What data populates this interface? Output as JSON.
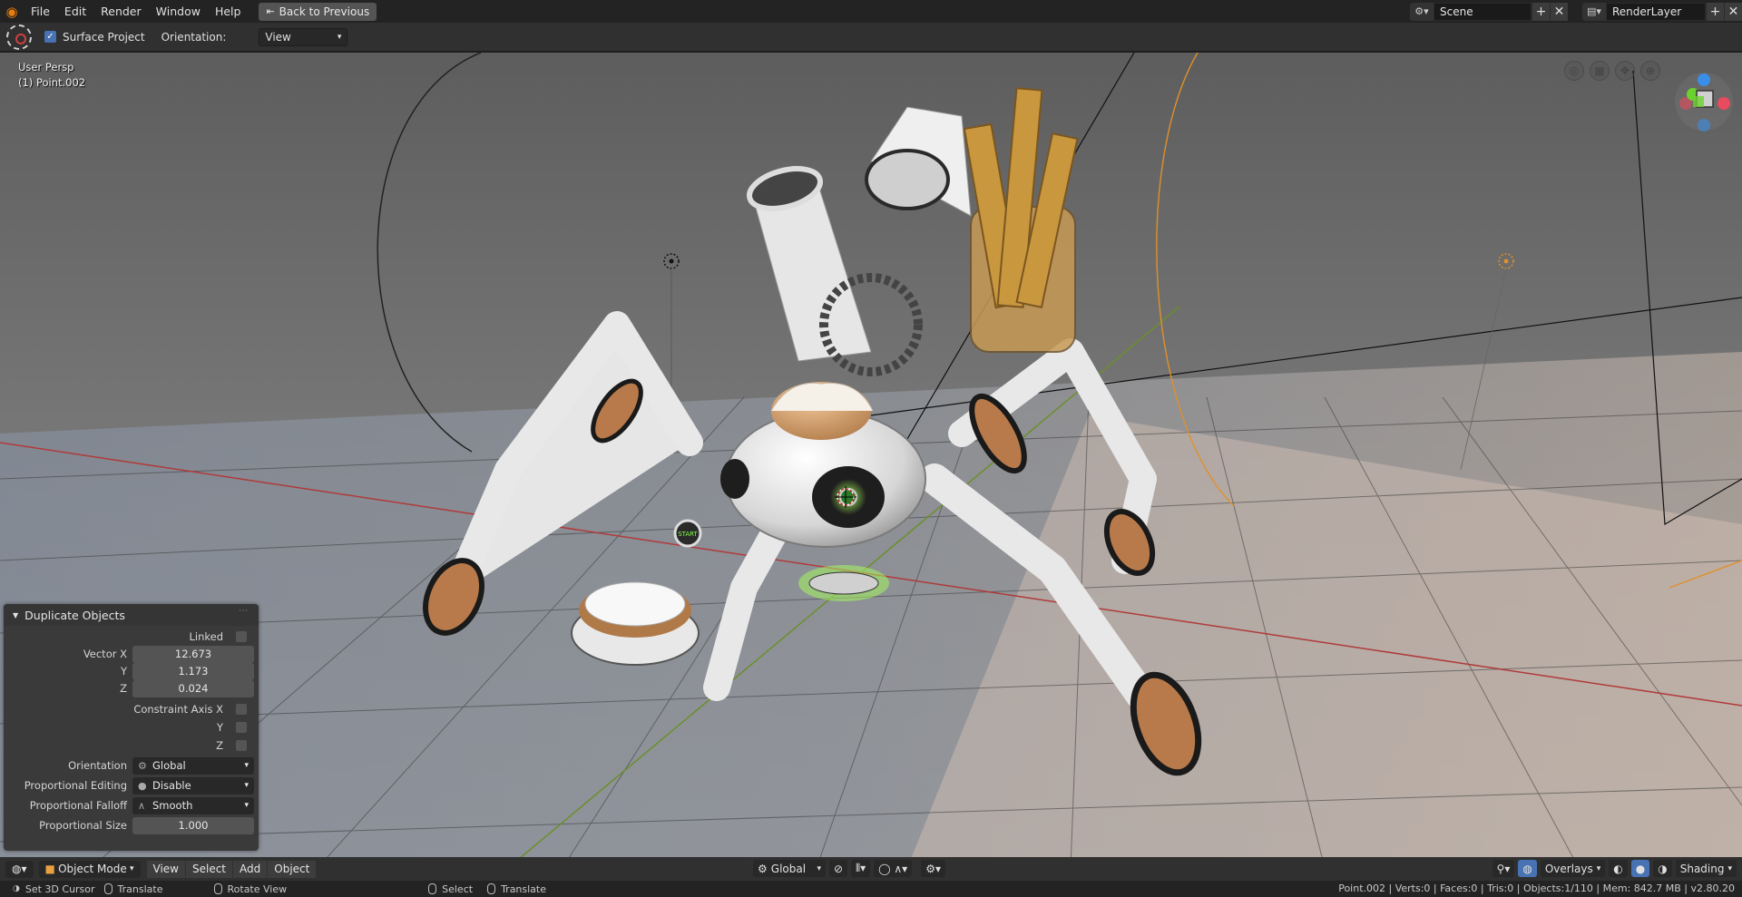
{
  "topbar": {
    "logo_icon": "blender-logo-icon",
    "menus": [
      "File",
      "Edit",
      "Render",
      "Window",
      "Help"
    ],
    "back_button": "Back to Previous",
    "scene_name": "Scene",
    "render_layer": "RenderLayer"
  },
  "tool_header": {
    "surface_project_label": "Surface Project",
    "surface_project_checked": true,
    "orientation_label": "Orientation:",
    "orientation_value": "View"
  },
  "viewport": {
    "view_name": "User Persp",
    "active_object": "(1) Point.002",
    "start_label": "START"
  },
  "redo_panel": {
    "title": "Duplicate Objects",
    "linked_label": "Linked",
    "vector_x_label": "Vector X",
    "vector_x": "12.673",
    "vector_y_label": "Y",
    "vector_y": "1.173",
    "vector_z_label": "Z",
    "vector_z": "0.024",
    "constraint_x_label": "Constraint Axis X",
    "constraint_y_label": "Y",
    "constraint_z_label": "Z",
    "orientation_label": "Orientation",
    "orientation_value": "Global",
    "prop_edit_label": "Proportional Editing",
    "prop_edit_value": "Disable",
    "prop_falloff_label": "Proportional Falloff",
    "prop_falloff_value": "Smooth",
    "prop_size_label": "Proportional Size",
    "prop_size_value": "1.000"
  },
  "bottom_header": {
    "mode": "Object Mode",
    "menus": [
      "View",
      "Select",
      "Add",
      "Object"
    ],
    "transform_orientation": "Global",
    "overlays": "Overlays",
    "shading": "Shading"
  },
  "statusbar": {
    "set_cursor": "Set 3D Cursor",
    "translate1": "Translate",
    "rotate_view": "Rotate View",
    "select": "Select",
    "translate2": "Translate",
    "info": "Point.002 | Verts:0 | Faces:0 | Tris:0 | Objects:1/110 | Mem: 842.7 MB | v2.80.20"
  },
  "colors": {
    "accent": "#4772b3",
    "header": "#303030",
    "topbar": "#232323",
    "grid_red_axis": "#b03a3a",
    "grid_green_axis": "#6b8f2a",
    "spot_light": "#e0902a"
  }
}
